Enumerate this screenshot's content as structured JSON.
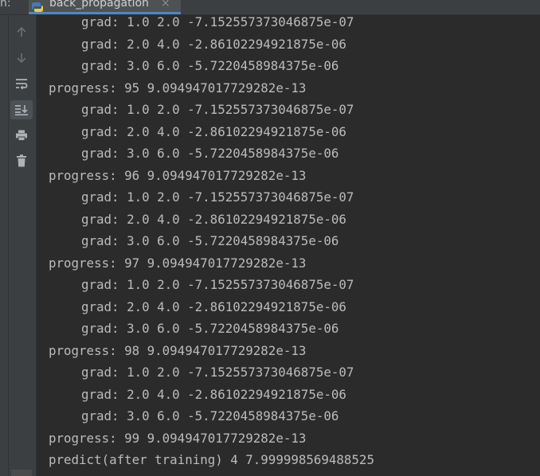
{
  "header": {
    "run_label": "n:",
    "tab_title": "back_propagation",
    "tab_close": "×"
  },
  "toolbar": {
    "tools": [
      {
        "name": "up-arrow-icon",
        "glyph": "↑"
      },
      {
        "name": "down-arrow-icon",
        "glyph": "↓"
      },
      {
        "name": "soft-wrap-icon",
        "glyph": "wrap"
      },
      {
        "name": "scroll-to-end-icon",
        "glyph": "end",
        "active": true
      },
      {
        "name": "print-icon",
        "glyph": "print"
      },
      {
        "name": "trash-icon",
        "glyph": "delete"
      }
    ]
  },
  "console": {
    "lines": [
      {
        "text": "grad: 1.0 2.0 -7.152557373046875e-07",
        "indent": true
      },
      {
        "text": "grad: 2.0 4.0 -2.86102294921875e-06",
        "indent": true
      },
      {
        "text": "grad: 3.0 6.0 -5.7220458984375e-06",
        "indent": true
      },
      {
        "text": "progress: 95 9.094947017729282e-13",
        "indent": false
      },
      {
        "text": "grad: 1.0 2.0 -7.152557373046875e-07",
        "indent": true
      },
      {
        "text": "grad: 2.0 4.0 -2.86102294921875e-06",
        "indent": true
      },
      {
        "text": "grad: 3.0 6.0 -5.7220458984375e-06",
        "indent": true
      },
      {
        "text": "progress: 96 9.094947017729282e-13",
        "indent": false
      },
      {
        "text": "grad: 1.0 2.0 -7.152557373046875e-07",
        "indent": true
      },
      {
        "text": "grad: 2.0 4.0 -2.86102294921875e-06",
        "indent": true
      },
      {
        "text": "grad: 3.0 6.0 -5.7220458984375e-06",
        "indent": true
      },
      {
        "text": "progress: 97 9.094947017729282e-13",
        "indent": false
      },
      {
        "text": "grad: 1.0 2.0 -7.152557373046875e-07",
        "indent": true
      },
      {
        "text": "grad: 2.0 4.0 -2.86102294921875e-06",
        "indent": true
      },
      {
        "text": "grad: 3.0 6.0 -5.7220458984375e-06",
        "indent": true
      },
      {
        "text": "progress: 98 9.094947017729282e-13",
        "indent": false
      },
      {
        "text": "grad: 1.0 2.0 -7.152557373046875e-07",
        "indent": true
      },
      {
        "text": "grad: 2.0 4.0 -2.86102294921875e-06",
        "indent": true
      },
      {
        "text": "grad: 3.0 6.0 -5.7220458984375e-06",
        "indent": true
      },
      {
        "text": "progress: 99 9.094947017729282e-13",
        "indent": false
      },
      {
        "text": "predict(after training) 4 7.999998569488525",
        "indent": false
      }
    ]
  },
  "colors": {
    "background": "#2b2b2b",
    "panel": "#3c3f41",
    "text": "#bbbbbb",
    "tab_accent": "#4a88c7",
    "icon": "#a0a0a0"
  }
}
